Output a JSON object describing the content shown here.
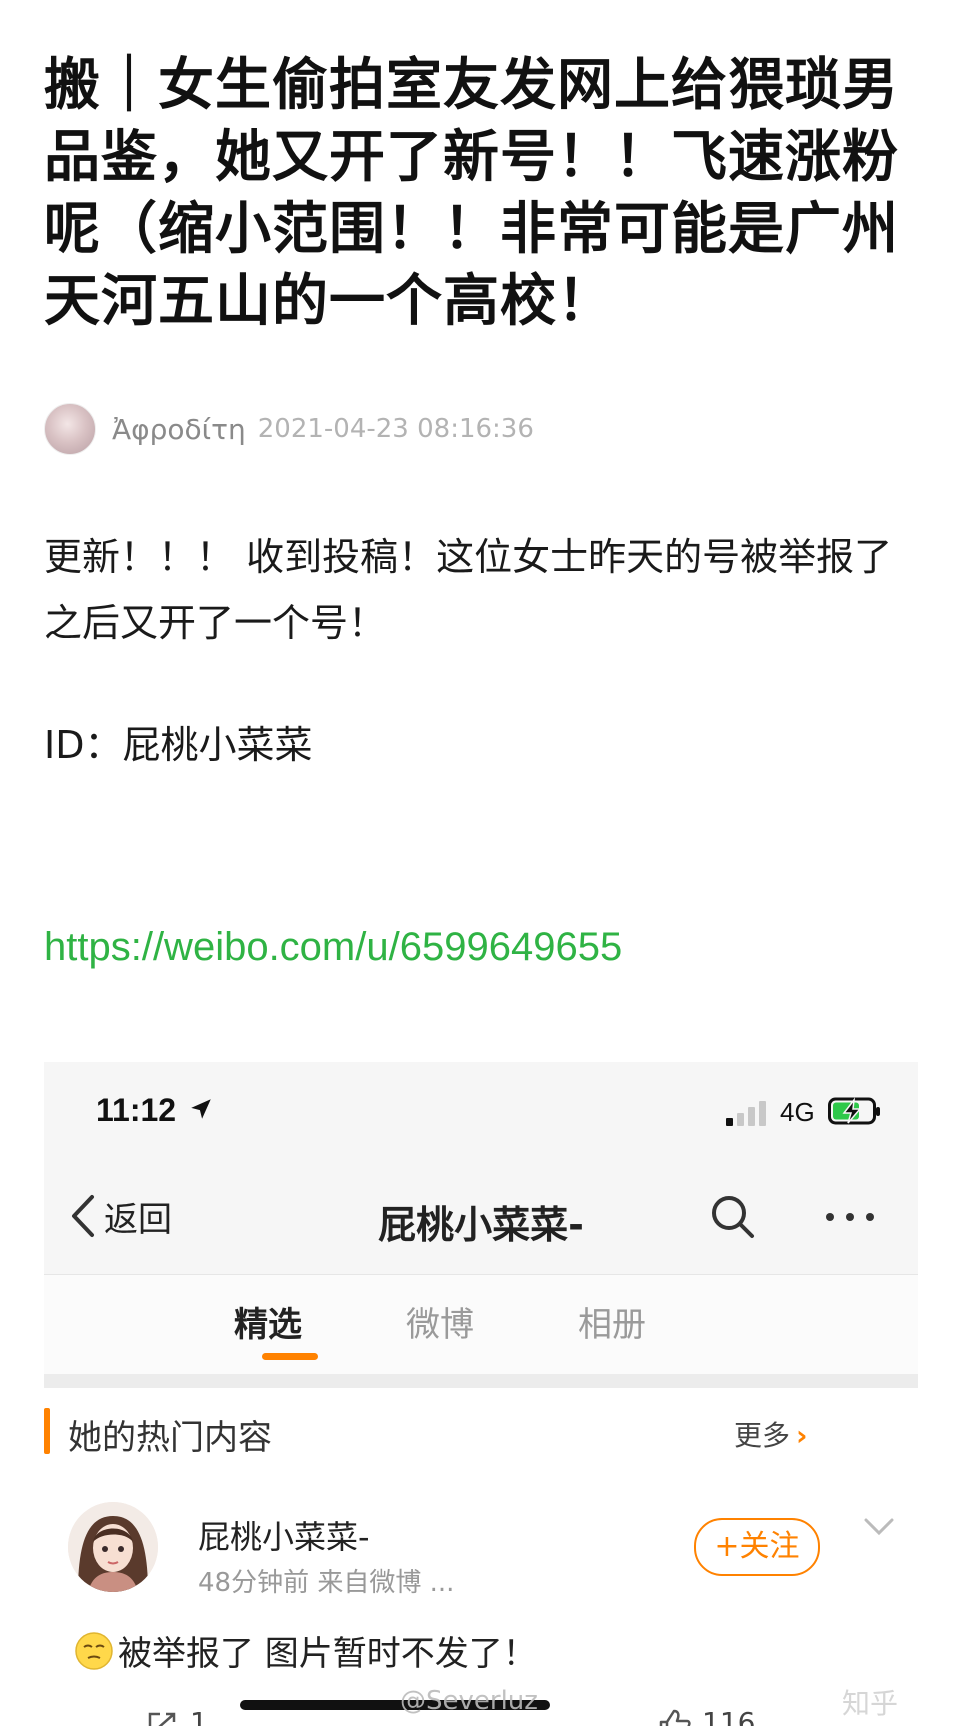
{
  "article": {
    "title": "搬｜女生偷拍室友发网上给猥琐男品鉴，她又开了新号！！飞速涨粉呢（缩小范围！！非常可能是广州天河五山的一个高校！",
    "author": "Ἀφροδίτη",
    "timestamp": "2021-04-23 08:16:36",
    "paragraph1": "更新！！！ 收到投稿！这位女士昨天的号被举报了之后又开了一个号！",
    "id_line": "ID：屁桃小菜菜",
    "link": "https://weibo.com/u/6599649655"
  },
  "phone": {
    "status_time": "11:12",
    "network": "4G",
    "nav": {
      "back_label": "返回",
      "title": "屁桃小菜菜-"
    },
    "tabs": [
      {
        "label": "精选",
        "active": true
      },
      {
        "label": "微博",
        "active": false
      },
      {
        "label": "相册",
        "active": false
      }
    ],
    "hot": {
      "title": "她的热门内容",
      "more": "更多"
    },
    "post": {
      "name": "屁桃小菜菜-",
      "meta": "48分钟前  来自微博 ...",
      "follow_label": "+关注",
      "text": "被举报了 图片暂时不发了！",
      "share_count": "1",
      "like_count": "116"
    }
  },
  "watermarks": {
    "weibo": "@Severluz",
    "zhihu": "知乎"
  },
  "colors": {
    "accent": "#ff8200",
    "link": "#2fb344"
  },
  "icons": [
    "location-arrow-icon",
    "signal-icon",
    "battery-charging-icon",
    "back-chevron-icon",
    "search-icon",
    "more-dots-icon",
    "dropdown-chevron-icon",
    "share-icon",
    "like-icon",
    "emoji-icon"
  ]
}
